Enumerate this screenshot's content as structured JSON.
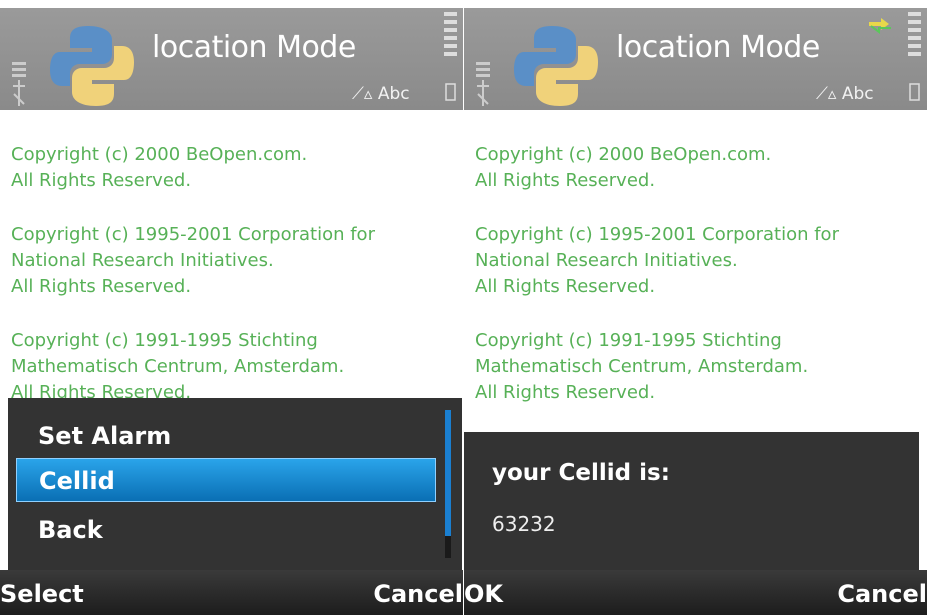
{
  "screens": [
    {
      "header": {
        "title": "location Mode",
        "indicator": "Abc"
      },
      "copyright": [
        "Copyright (c) 2000 BeOpen.com.\nAll Rights Reserved.",
        "Copyright (c) 1995-2001 Corporation for\nNational Research Initiatives.\nAll Rights Reserved.",
        "Copyright (c) 1991-1995 Stichting\nMathematisch Centrum, Amsterdam.\nAll Rights Reserved."
      ],
      "menu": {
        "items": [
          "Set Alarm",
          "Cellid",
          "Back"
        ],
        "selected": "Cellid"
      },
      "softkeys": {
        "left": "Select",
        "right": "Cancel"
      }
    },
    {
      "header": {
        "title": "location Mode",
        "indicator": "Abc"
      },
      "copyright": [
        "Copyright (c) 2000 BeOpen.com.\nAll Rights Reserved.",
        "Copyright (c) 1995-2001 Corporation for\nNational Research Initiatives.\nAll Rights Reserved.",
        "Copyright (c) 1991-1995 Stichting\nMathematisch Centrum, Amsterdam.\nAll Rights Reserved."
      ],
      "dialog": {
        "title": "your Cellid is:",
        "value": "63232"
      },
      "softkeys": {
        "left": "OK",
        "right": "Cancel"
      }
    }
  ],
  "colors": {
    "header": "#8f8f8f",
    "text_green": "#57b157",
    "selection": "#1a8ad4",
    "dark_panel": "#333333"
  },
  "icons": [
    "python-logo",
    "signal-icon",
    "battery-icon",
    "pen-icon",
    "data-arrows-icon"
  ]
}
